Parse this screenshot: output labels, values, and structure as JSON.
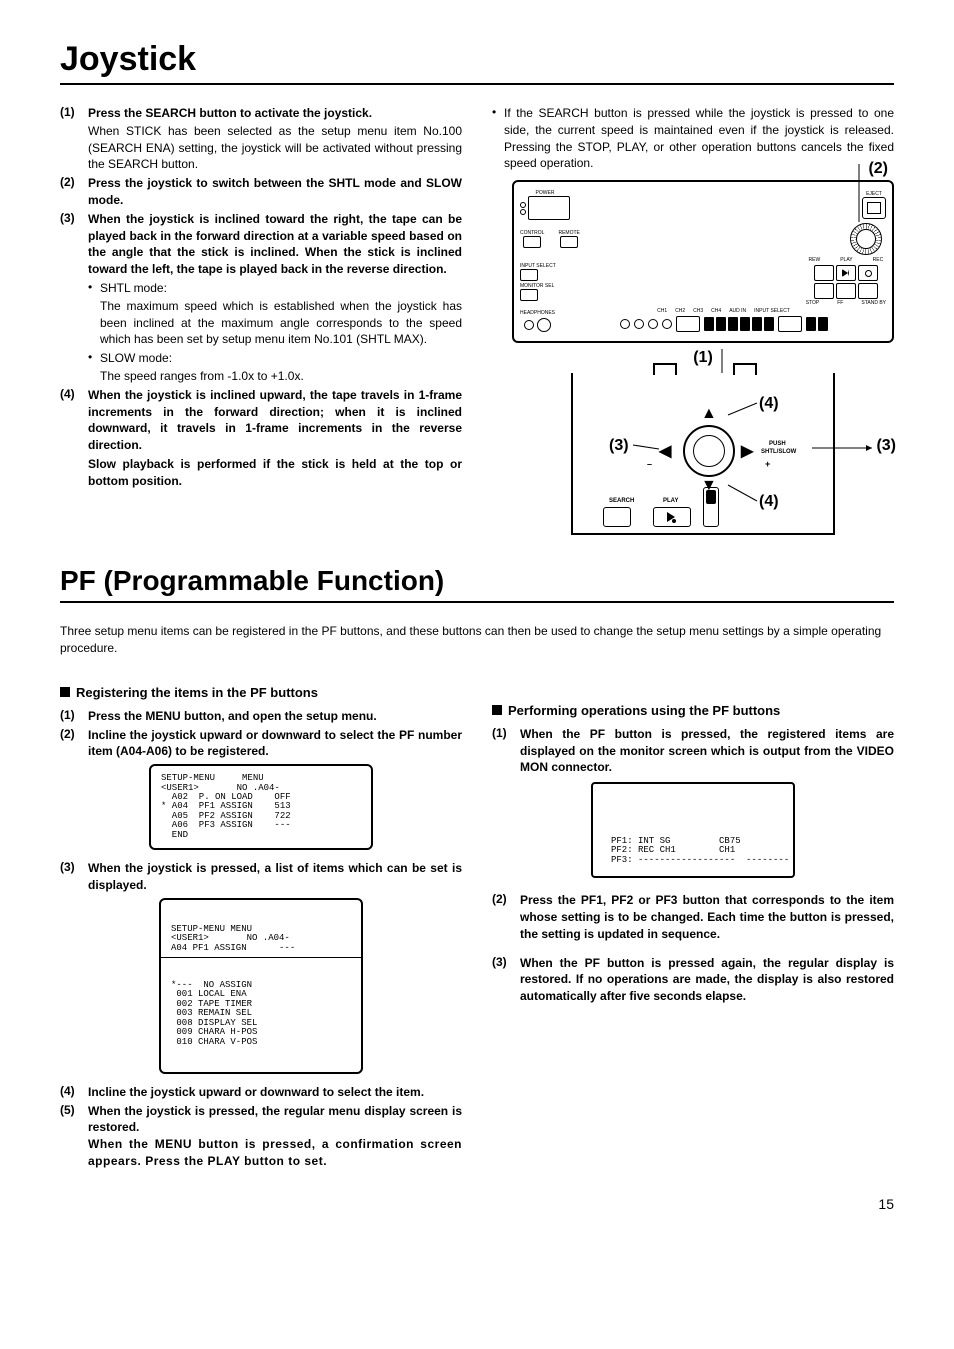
{
  "joystick": {
    "title": "Joystick",
    "items": [
      {
        "num": "(1)",
        "head": "Press the SEARCH button to activate the joystick.",
        "sub": "When STICK has been selected as the setup menu item No.100 (SEARCH ENA) setting, the joystick will be activated without pressing the SEARCH button."
      },
      {
        "num": "(2)",
        "head": "Press the joystick to switch between the SHTL mode and SLOW mode."
      },
      {
        "num": "(3)",
        "head": "When the joystick is inclined toward the right, the tape can be played back in the forward direction at a variable speed based on the angle that the stick is inclined. When the stick is inclined toward the left, the tape is played back in the reverse direction.",
        "bullets": [
          {
            "title": "SHTL mode:",
            "text": "The maximum speed which is established when the joystick has been inclined at the maximum angle corresponds to the speed which has been set by setup menu item No.101 (SHTL MAX)."
          },
          {
            "title": "SLOW mode:",
            "text": "The speed ranges from -1.0x to +1.0x."
          }
        ]
      },
      {
        "num": "(4)",
        "head": "When the joystick is inclined upward, the tape travels in 1-frame increments in the forward direction; when it is inclined downward, it travels in 1-frame increments in the reverse direction.",
        "head2": "Slow playback is performed if the stick is held at the top or bottom position."
      }
    ],
    "right_bullet": "If the SEARCH button is pressed while the joystick is pressed to one side, the current speed is maintained even if the joystick is released. Pressing the STOP, PLAY, or other operation buttons cancels the fixed speed operation.",
    "panel_labels": {
      "power": "POWER",
      "control": "CONTROL",
      "remote": "REMOTE",
      "input_select": "INPUT SELECT",
      "monitor_sel": "MONITOR SEL",
      "headphones": "HEADPHONES",
      "ch1": "CH1",
      "ch2": "CH2",
      "ch3": "CH3",
      "ch4": "CH4",
      "aud_in": "AUD IN",
      "input_select2": "INPUT SELECT",
      "rew": "REW",
      "play": "PLAY",
      "rec": "REC",
      "stop": "STOP",
      "ff": "FF",
      "standby": "STAND BY",
      "eject": "EJECT"
    },
    "callouts": {
      "c1": "(1)",
      "c2": "(2)",
      "c3": "(3)",
      "c4": "(4)"
    },
    "joy_labels": {
      "search": "SEARCH",
      "play": "PLAY",
      "push": "PUSH",
      "shtl": "SHTL/SLOW",
      "fwd": "+",
      "rev": "–"
    }
  },
  "pf": {
    "title": "PF (Programmable Function)",
    "intro": "Three setup menu items can be registered in the PF buttons, and these buttons can then be used to change the setup menu settings by a simple operating procedure.",
    "left_head": "Registering the items in the PF buttons",
    "left_items": [
      {
        "num": "(1)",
        "head": "Press the MENU button, and open the setup menu."
      },
      {
        "num": "(2)",
        "head": "Incline the joystick upward or downward to select the PF number item (A04-A06) to be registered."
      },
      {
        "num": "(3)",
        "head": "When the joystick is pressed, a list of items which can be set is displayed."
      },
      {
        "num": "(4)",
        "head": "Incline the joystick upward or downward to select the item."
      },
      {
        "num": "(5)",
        "head": "When the joystick is pressed, the regular menu display screen is restored.",
        "head2": "When the MENU button is pressed, a confirmation screen appears. Press the PLAY button to set."
      }
    ],
    "menu1": "SETUP-MENU     MENU\n<USER1>       NO .A04-\n  A02  P. ON LOAD    OFF\n* A04  PF1 ASSIGN    513\n  A05  PF2 ASSIGN    722\n  A06  PF3 ASSIGN    ---\n  END",
    "menu2_top": "SETUP-MENU MENU\n<USER1>       NO .A04-\nA04 PF1 ASSIGN      ---",
    "menu2_bot": "*---  NO ASSIGN\n 001 LOCAL ENA\n 002 TAPE TIMER\n 003 REMAIN SEL\n 008 DISPLAY SEL\n 009 CHARA H-POS\n 010 CHARA V-POS",
    "right_head": "Performing operations using the PF buttons",
    "right_items": [
      {
        "num": "(1)",
        "head": "When the PF button is pressed, the registered items are displayed on the monitor screen which is output from the VIDEO MON connector."
      },
      {
        "num": "(2)",
        "head": "Press the PF1, PF2 or PF3 button that corresponds to the item whose setting is to be changed.  Each time the button is pressed, the setting is updated in sequence."
      },
      {
        "num": "(3)",
        "head": "When the PF button is pressed again, the regular display is restored. If no operations are made, the display is also restored automatically after five seconds elapse."
      }
    ],
    "pf_monitor": "PF1: INT SG         CB75\nPF2: REC CH1        CH1\nPF3: ------------------  --------"
  },
  "page_number": "15"
}
